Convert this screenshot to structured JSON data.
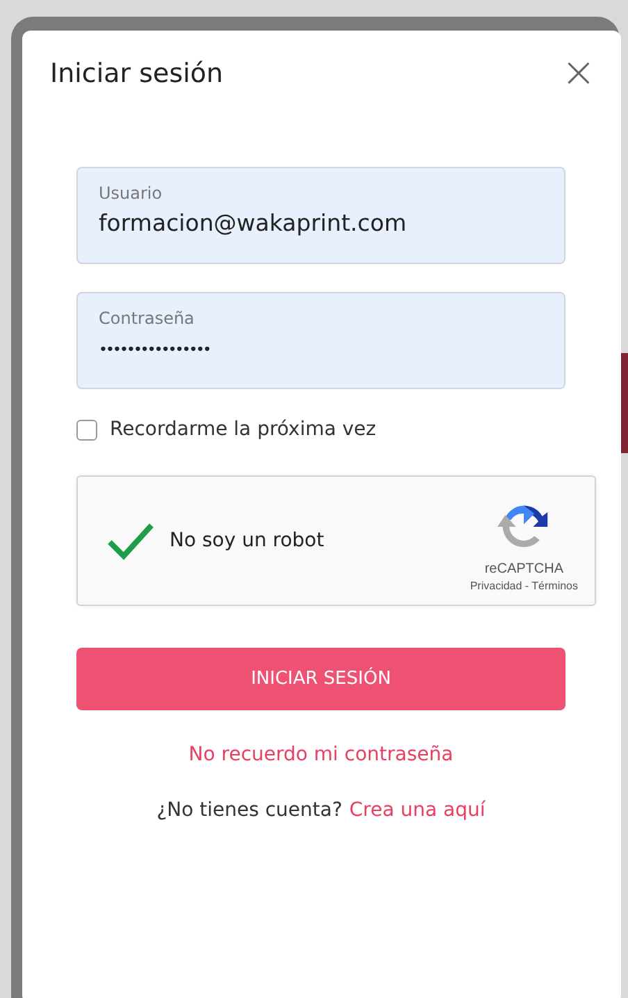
{
  "dialog": {
    "title": "Iniciar sesión",
    "close": "×"
  },
  "fields": [
    {
      "label": "Usuario",
      "value": "formacion@wakaprint.com"
    },
    {
      "label": "Contraseña",
      "value": "••••••••••••••••"
    }
  ],
  "remember": {
    "label": "Recordarme la próxima vez",
    "checked": false
  },
  "captcha": {
    "label": "No soy un robot",
    "checked": true,
    "brand": "reCAPTCHA",
    "links": "Privacidad - Términos"
  },
  "submit": "INICIAR SESIÓN",
  "forgot_link": "No recuerdo mi contraseña",
  "signup": {
    "text": "¿No tienes cuenta?",
    "link": "Crea una aquí"
  }
}
